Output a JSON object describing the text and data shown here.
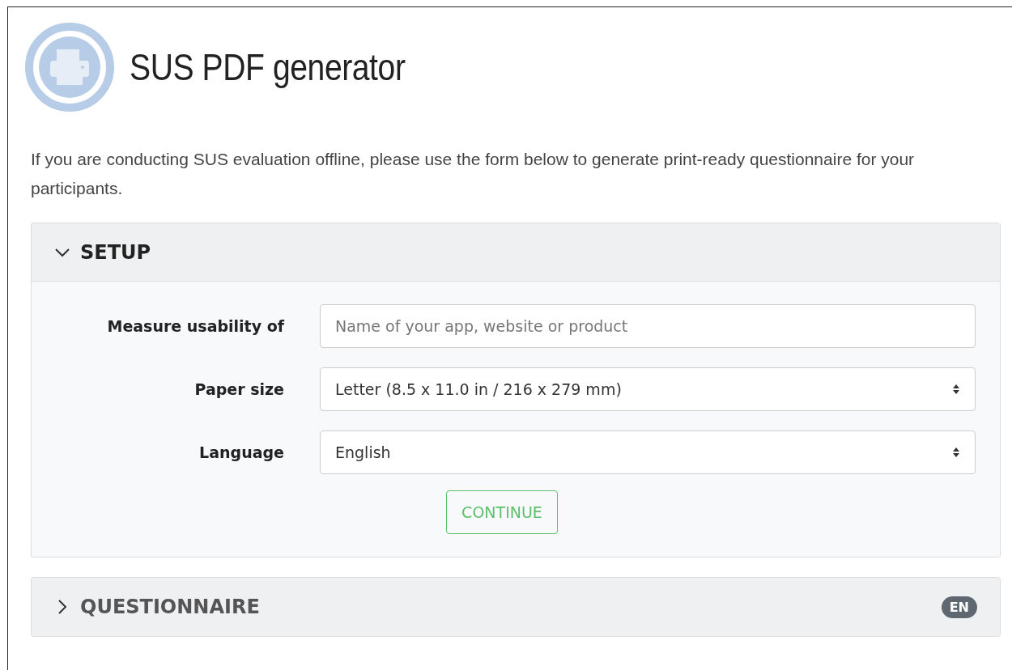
{
  "header": {
    "title": "SUS PDF generator"
  },
  "intro": "If you are conducting SUS evaluation offline, please use the form below to generate print-ready questionnaire for your participants.",
  "panels": [
    {
      "title": "SETUP",
      "expanded": true,
      "fields": [
        {
          "kind": "text",
          "label": "Measure usability of",
          "placeholder": "Name of your app, website or product"
        },
        {
          "kind": "select",
          "label": "Paper size",
          "value": "Letter (8.5 x 11.0 in / 216 x 279 mm)"
        },
        {
          "kind": "select",
          "label": "Language",
          "value": "English"
        }
      ],
      "button": "CONTINUE"
    },
    {
      "title": "QUESTIONNAIRE",
      "expanded": false,
      "badge": "EN"
    }
  ]
}
